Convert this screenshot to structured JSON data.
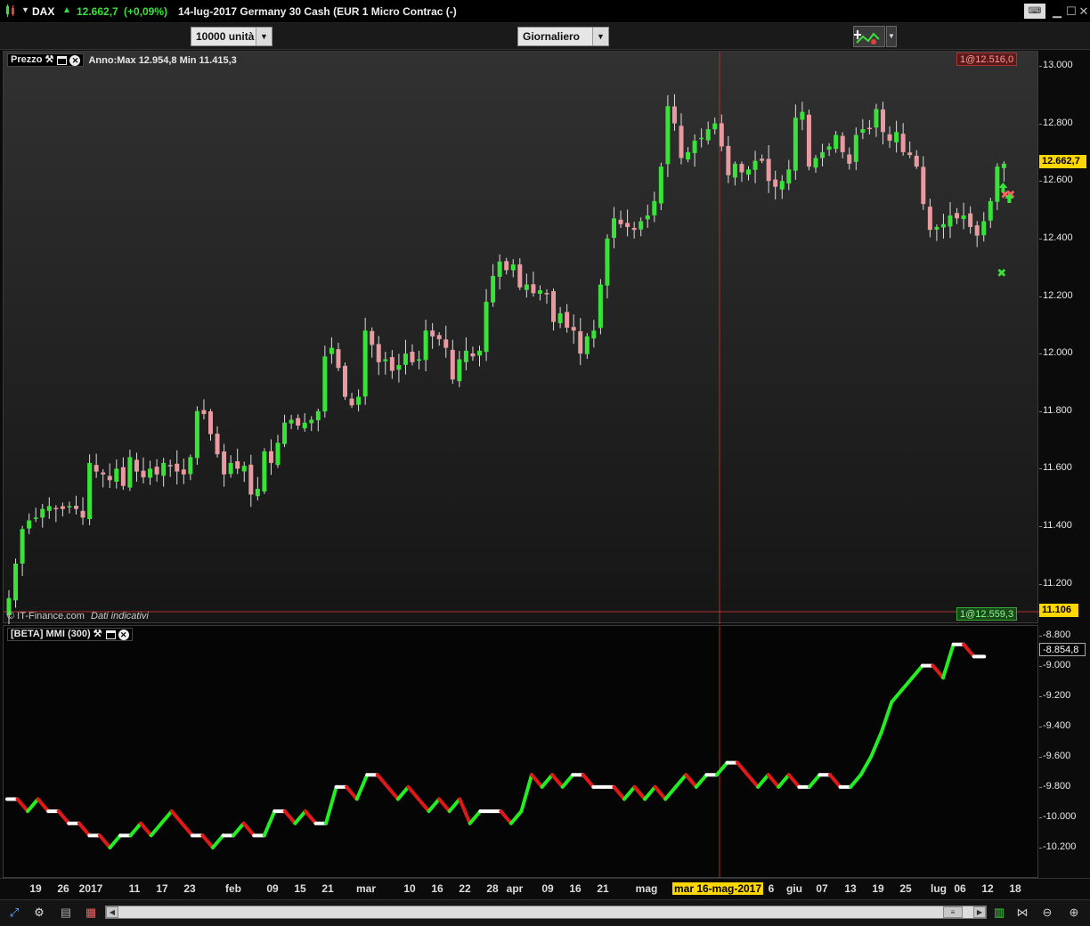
{
  "title_bar": {
    "symbol": "DAX",
    "last_price": "12.662,7",
    "change": "(+0,09%)",
    "date_instrument": "14-lug-2017 Germany 30 Cash (EUR 1 Micro Contrac (-)"
  },
  "toolbar": {
    "quantity": "10000 unità",
    "timeframe": "Giornaliero"
  },
  "price_panel": {
    "name": "Prezzo",
    "range_info": "Anno:Max 12.954,8 Min 11.415,3",
    "order_top": "1@12.516,0",
    "order_bottom": "1@12.559,3",
    "copyright": "© IT-Finance.com",
    "disclaimer": "Dati indicativi",
    "price_tag": "12.662,7",
    "crosshair_price": "11.106",
    "y_labels": [
      "13.000",
      "12.800",
      "12.600",
      "12.400",
      "12.200",
      "12.000",
      "11.800",
      "11.600",
      "11.400",
      "11.200"
    ]
  },
  "mmi_panel": {
    "name": "[BETA] MMI (300)",
    "value_tag": "-8.854,8",
    "y_labels": [
      "-8.800",
      "-9.000",
      "-9.200",
      "-9.400",
      "-9.600",
      "-9.800",
      "-10.000",
      "-10.200"
    ]
  },
  "x_axis": {
    "labels": [
      "19",
      "26",
      "2017",
      "11",
      "17",
      "23",
      "feb",
      "09",
      "15",
      "21",
      "mar",
      "10",
      "16",
      "22",
      "28",
      "apr",
      "09",
      "16",
      "21",
      "mag",
      "mar 16-mag-2017",
      "6",
      "giu",
      "07",
      "13",
      "19",
      "25",
      "lug",
      "06",
      "12",
      "18"
    ]
  },
  "colors": {
    "up": "#39e239",
    "down": "#e89aa0",
    "mmi_up": "#22ee22",
    "mmi_down": "#e01818",
    "mmi_flat": "#ffffff",
    "highlight": "#ffd700"
  },
  "chart_data": [
    {
      "type": "candlestick",
      "title": "",
      "ylim": [
        11106,
        13000
      ],
      "series": [
        {
          "close": [
            11150,
            11270,
            11390,
            11420,
            11430,
            11460,
            11470,
            11460,
            11460,
            11470,
            11460,
            11430,
            11620,
            11590,
            11580,
            11560,
            11600,
            11540,
            11640,
            11590,
            11570,
            11600,
            11580,
            11620,
            11610,
            11590,
            11580,
            11640,
            11800,
            11790,
            11720,
            11650,
            11580,
            11620,
            11600,
            11610,
            11510,
            11530,
            11660,
            11620,
            11690,
            11760,
            11770,
            11750,
            11760,
            11770,
            11800,
            11990,
            12020,
            11950,
            11850,
            11820,
            11850,
            12080,
            12030,
            11970,
            11980,
            11940,
            11960,
            12000,
            11970,
            11980,
            12080,
            12060,
            12050,
            12020,
            11910,
            11980,
            12010,
            11990,
            12010,
            12180,
            12270,
            12320,
            12290,
            12310,
            12230,
            12240,
            12210,
            12220,
            12210,
            12110,
            12140,
            12090,
            12080,
            12000,
            12060,
            12080,
            12240,
            12400,
            12470,
            12450,
            12440,
            12430,
            12460,
            12480,
            12530,
            12650,
            12860,
            12800,
            12680,
            12700,
            12740,
            12750,
            12780,
            12800,
            12720,
            12620,
            12660,
            12630,
            12640,
            12670,
            12670,
            12600,
            12580,
            12600,
            12640,
            12820,
            12840,
            12650,
            12680,
            12700,
            12720,
            12760,
            12700,
            12660,
            12760,
            12780,
            12780,
            12850,
            12770,
            12740,
            12770,
            12700,
            12690,
            12650,
            12520,
            12430,
            12440,
            12450,
            12480,
            12470,
            12480,
            12440,
            12410,
            12460,
            12530,
            12650,
            12660
          ]
        }
      ]
    },
    {
      "type": "line",
      "title": "",
      "ylim": [
        -10300,
        -8750
      ],
      "series": [
        {
          "name": "[BETA] MMI (300)",
          "values": [
            -9880,
            -9880,
            -9960,
            -9880,
            -9960,
            -9960,
            -10040,
            -10040,
            -10120,
            -10120,
            -10200,
            -10120,
            -10120,
            -10040,
            -10120,
            -10040,
            -9960,
            -10040,
            -10120,
            -10120,
            -10200,
            -10120,
            -10120,
            -10040,
            -10120,
            -10120,
            -9960,
            -9960,
            -10040,
            -9960,
            -10040,
            -10040,
            -9800,
            -9800,
            -9880,
            -9720,
            -9720,
            -9800,
            -9880,
            -9800,
            -9880,
            -9960,
            -9880,
            -9960,
            -9880,
            -10040,
            -9960,
            -9960,
            -9960,
            -10040,
            -9960,
            -9720,
            -9800,
            -9720,
            -9800,
            -9720,
            -9720,
            -9800,
            -9800,
            -9800,
            -9880,
            -9800,
            -9880,
            -9800,
            -9880,
            -9800,
            -9720,
            -9800,
            -9720,
            -9720,
            -9640,
            -9640,
            -9720,
            -9800,
            -9720,
            -9800,
            -9720,
            -9800,
            -9800,
            -9720,
            -9720,
            -9800,
            -9800,
            -9720,
            -9600,
            -9440,
            -9240,
            -9160,
            -9080,
            -9000,
            -9000,
            -9080,
            -8860,
            -8860,
            -8940,
            -8940
          ]
        }
      ]
    }
  ]
}
